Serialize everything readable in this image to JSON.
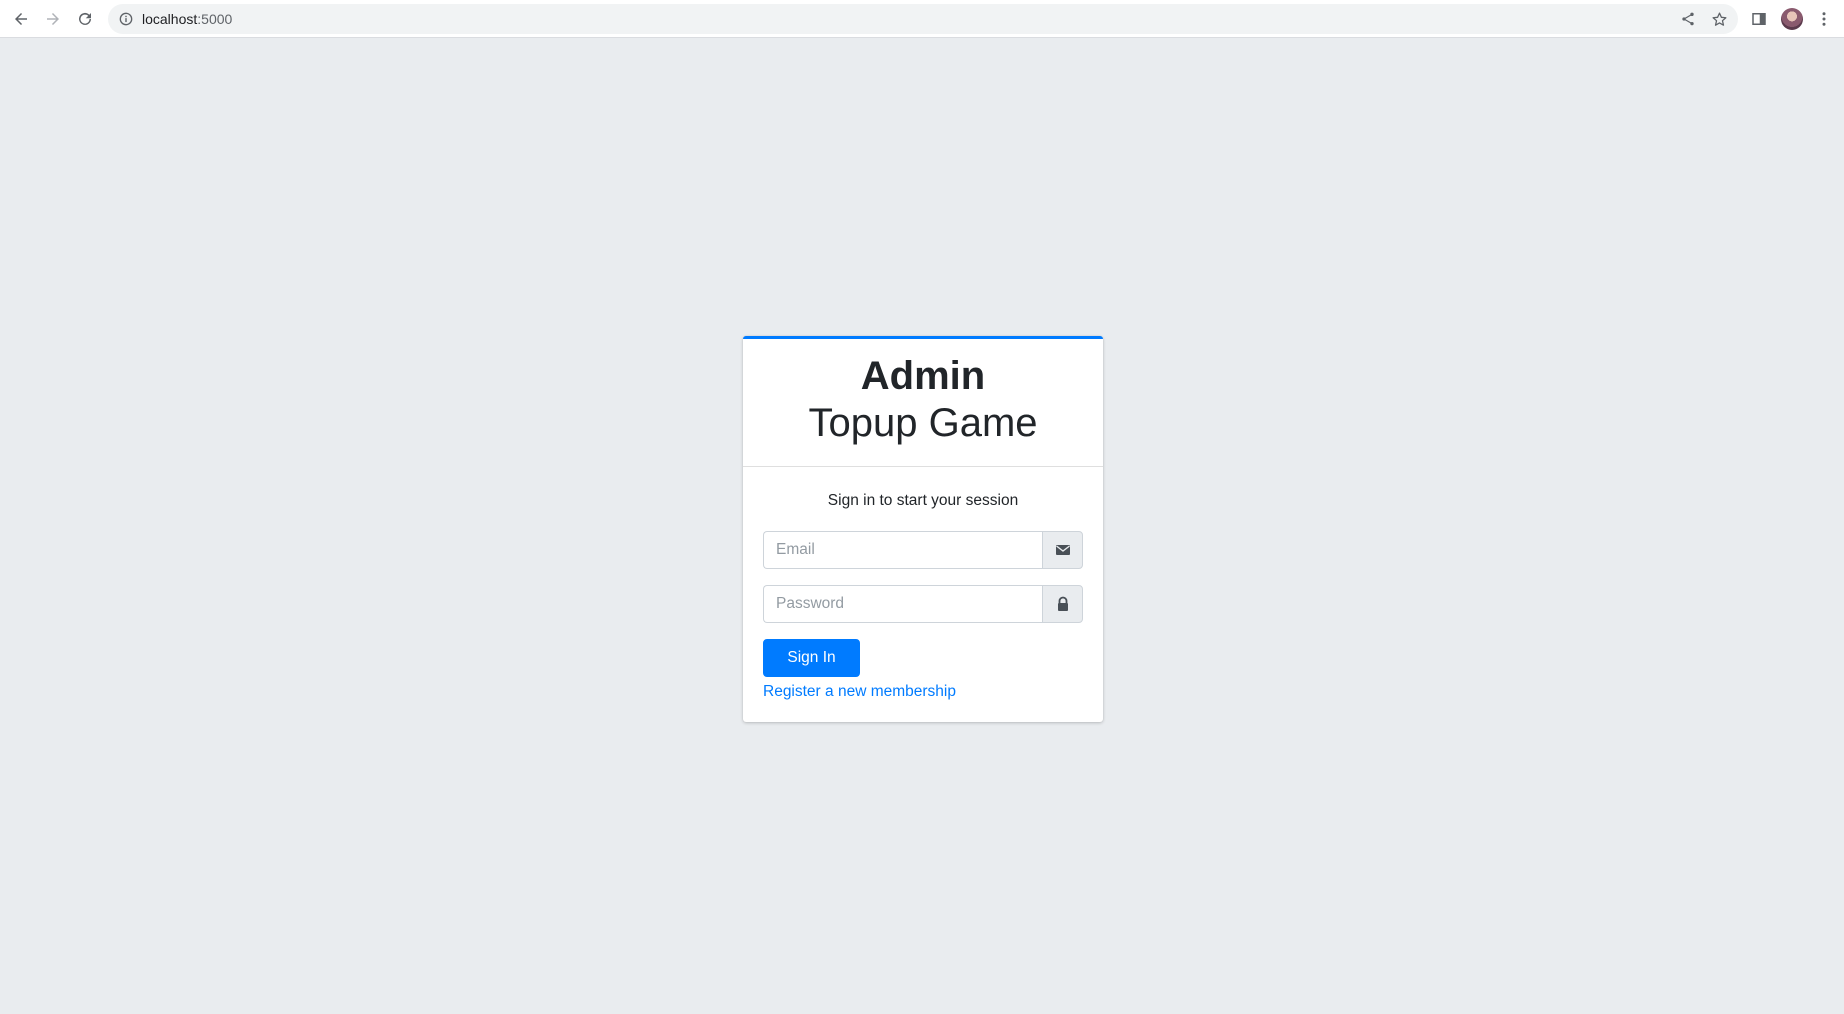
{
  "browser": {
    "url_host": "localhost",
    "url_port": ":5000"
  },
  "login": {
    "brand_bold": "Admin",
    "brand_light": "Topup Game",
    "message": "Sign in to start your session",
    "email_placeholder": "Email",
    "password_placeholder": "Password",
    "signin_label": "Sign In",
    "register_label": "Register a new membership"
  },
  "colors": {
    "accent": "#007bff",
    "background": "#e9ecef"
  },
  "icons": {
    "email_icon": "envelope-icon",
    "password_icon": "lock-icon"
  }
}
